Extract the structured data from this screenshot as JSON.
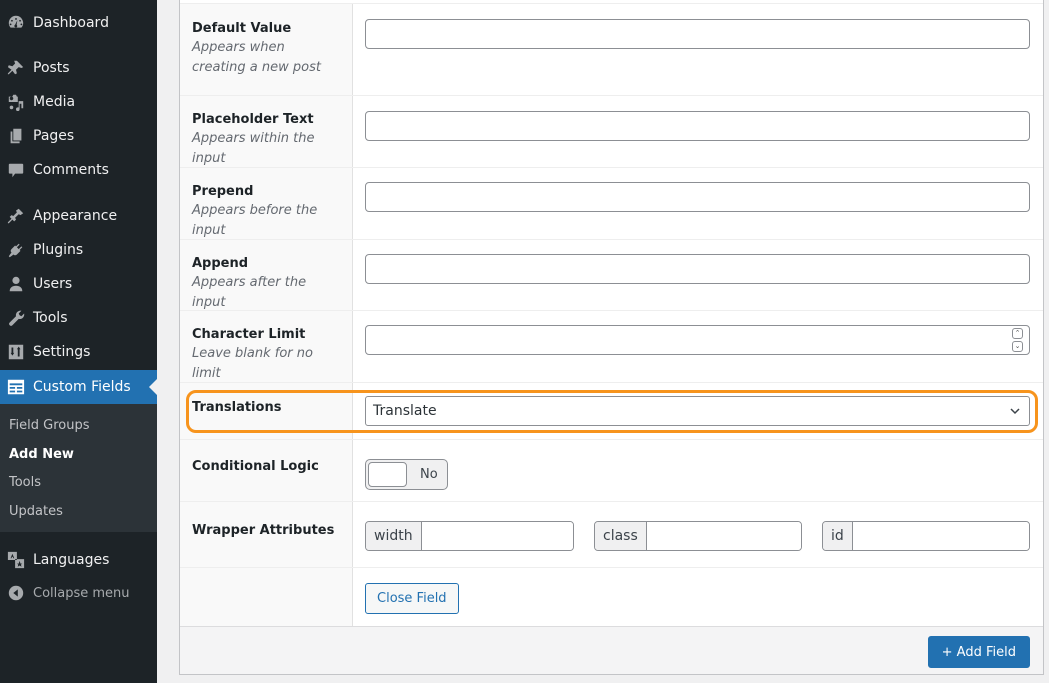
{
  "sidebar": {
    "items": [
      {
        "label": "Dashboard",
        "icon": "dashboard-icon"
      },
      {
        "label": "Posts",
        "icon": "pin-icon"
      },
      {
        "label": "Media",
        "icon": "media-icon"
      },
      {
        "label": "Pages",
        "icon": "pages-icon"
      },
      {
        "label": "Comments",
        "icon": "comment-icon"
      },
      {
        "label": "Appearance",
        "icon": "paintbrush-icon"
      },
      {
        "label": "Plugins",
        "icon": "plugin-icon"
      },
      {
        "label": "Users",
        "icon": "user-icon"
      },
      {
        "label": "Tools",
        "icon": "wrench-icon"
      },
      {
        "label": "Settings",
        "icon": "settings-icon"
      },
      {
        "label": "Custom Fields",
        "icon": "custom-fields-icon",
        "active": true
      }
    ],
    "submenu": [
      {
        "label": "Field Groups"
      },
      {
        "label": "Add New",
        "current": true
      },
      {
        "label": "Tools"
      },
      {
        "label": "Updates"
      }
    ],
    "languages": {
      "label": "Languages",
      "icon": "translation-icon"
    },
    "collapse": {
      "label": "Collapse menu",
      "icon": "collapse-arrow-icon"
    }
  },
  "fields": {
    "default_value": {
      "label": "Default Value",
      "desc": "Appears when creating a new post",
      "value": ""
    },
    "placeholder": {
      "label": "Placeholder Text",
      "desc": "Appears within the input",
      "value": ""
    },
    "prepend": {
      "label": "Prepend",
      "desc": "Appears before the input",
      "value": ""
    },
    "append": {
      "label": "Append",
      "desc": "Appears after the input",
      "value": ""
    },
    "char_limit": {
      "label": "Character Limit",
      "desc": "Leave blank for no limit",
      "value": ""
    },
    "translations": {
      "label": "Translations",
      "selected": "Translate"
    },
    "conditional_logic": {
      "label": "Conditional Logic",
      "toggle_label": "No",
      "enabled": false
    },
    "wrapper": {
      "label": "Wrapper Attributes",
      "width_label": "width",
      "width_value": "",
      "width_suffix": "%",
      "class_label": "class",
      "class_value": "",
      "id_label": "id",
      "id_value": ""
    }
  },
  "buttons": {
    "close_field": "Close Field",
    "add_field": "+ Add Field"
  },
  "colors": {
    "accent": "#2271b1",
    "highlight": "#f7941d",
    "sidebar_bg": "#1d2327"
  }
}
